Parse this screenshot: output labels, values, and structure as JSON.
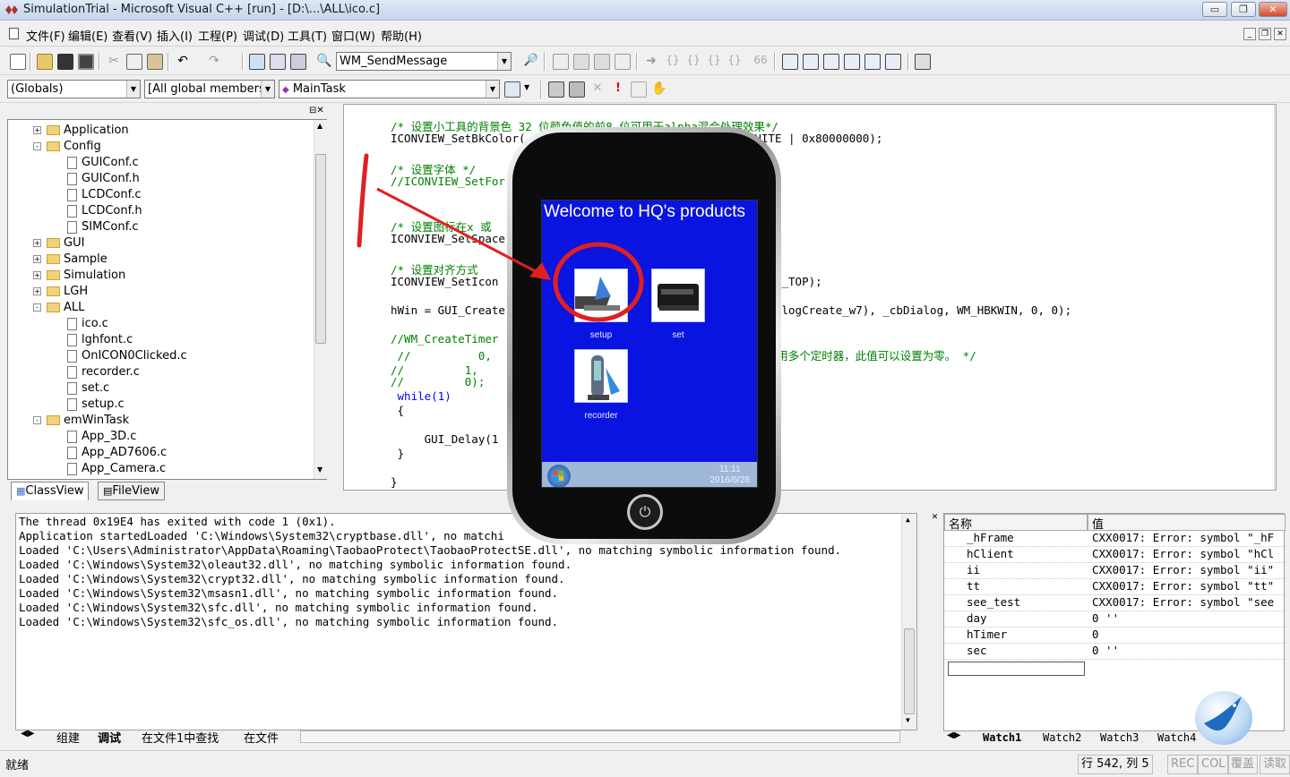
{
  "window": {
    "title": "SimulationTrial - Microsoft Visual C++ [run] - [D:\\...\\ALL\\ico.c]",
    "minimize": "▭",
    "restore": "❐",
    "close": "✕"
  },
  "menu": [
    "文件(F)",
    "编辑(E)",
    "查看(V)",
    "插入(I)",
    "工程(P)",
    "调试(D)",
    "工具(T)",
    "窗口(W)",
    "帮助(H)"
  ],
  "toolbar": {
    "find_combo": "WM_SendMessage",
    "scope_combo": "(Globals)",
    "members_combo": "[All global members",
    "function_combo": "MainTask"
  },
  "tree": {
    "items": [
      {
        "label": "Application",
        "type": "folder",
        "level": 1,
        "state": "+"
      },
      {
        "label": "Config",
        "type": "folder",
        "level": 1,
        "state": "-"
      },
      {
        "label": "GUIConf.c",
        "type": "file",
        "level": 2
      },
      {
        "label": "GUIConf.h",
        "type": "file",
        "level": 2
      },
      {
        "label": "LCDConf.c",
        "type": "file",
        "level": 2
      },
      {
        "label": "LCDConf.h",
        "type": "file",
        "level": 2
      },
      {
        "label": "SIMConf.c",
        "type": "file",
        "level": 2
      },
      {
        "label": "GUI",
        "type": "folder",
        "level": 1,
        "state": "+"
      },
      {
        "label": "Sample",
        "type": "folder",
        "level": 1,
        "state": "+"
      },
      {
        "label": "Simulation",
        "type": "folder",
        "level": 1,
        "state": "+"
      },
      {
        "label": "LGH",
        "type": "folder",
        "level": 1,
        "state": "+"
      },
      {
        "label": "ALL",
        "type": "folder",
        "level": 1,
        "state": "-"
      },
      {
        "label": "ico.c",
        "type": "file",
        "level": 2
      },
      {
        "label": "lghfont.c",
        "type": "file",
        "level": 2
      },
      {
        "label": "OnICON0Clicked.c",
        "type": "file",
        "level": 2
      },
      {
        "label": "recorder.c",
        "type": "file",
        "level": 2
      },
      {
        "label": "set.c",
        "type": "file",
        "level": 2
      },
      {
        "label": "setup.c",
        "type": "file",
        "level": 2
      },
      {
        "label": "emWinTask",
        "type": "folder",
        "level": 1,
        "state": "-"
      },
      {
        "label": "App_3D.c",
        "type": "file",
        "level": 2
      },
      {
        "label": "App_AD7606.c",
        "type": "file",
        "level": 2
      },
      {
        "label": "App_Camera.c",
        "type": "file",
        "level": 2
      }
    ],
    "tabs": [
      "ClassView",
      "FileView"
    ]
  },
  "editor": {
    "lines": [
      {
        "text": "/* 设置小工具的背景色 32 位颜色值的前8 位可用于alpha混合处理效果*/",
        "cls": "cm"
      },
      {
        "text": "ICONVIEW_SetBkColor(                                 WHITE | 0x80000000);",
        "cls": ""
      },
      {
        "text": "",
        "cls": ""
      },
      {
        "text": "/* 设置字体 */",
        "cls": "cm"
      },
      {
        "text": "//ICONVIEW_SetFor",
        "cls": "cm"
      },
      {
        "text": "",
        "cls": ""
      },
      {
        "text": "",
        "cls": ""
      },
      {
        "text": "/* 设置图标在x 或",
        "cls": "cm"
      },
      {
        "text": "ICONVIEW_SetSpace",
        "cls": ""
      },
      {
        "text": "",
        "cls": ""
      },
      {
        "text": "/* 设置对齐方式 ",
        "cls": "cm"
      },
      {
        "text": "ICONVIEW_SetIcon                                 ONVIEW_IA_TOP);",
        "cls": ""
      },
      {
        "text": "",
        "cls": ""
      },
      {
        "text": "hWin = GUI_Create                                TOF(_aDialogCreate_w7), _cbDialog, WM_HBKWIN, 0, 0);",
        "cls": ""
      },
      {
        "text": "",
        "cls": ""
      },
      {
        "text": "//WM_CreateTimer                                 ",
        "cls": "cm"
      },
      {
        "text": " //          0,                                  同一窗口使用多个定时器，此值可以设置为零。 */",
        "cls": "cm"
      },
      {
        "text": "//         1,                                    消息*/",
        "cls": "cm"
      },
      {
        "text": "//         0);",
        "cls": "cm"
      },
      {
        "text": " while(1)",
        "cls": "kw"
      },
      {
        "text": " {",
        "cls": ""
      },
      {
        "text": "",
        "cls": ""
      },
      {
        "text": "     GUI_Delay(1",
        "cls": ""
      },
      {
        "text": " }",
        "cls": ""
      },
      {
        "text": "",
        "cls": ""
      },
      {
        "text": "}",
        "cls": ""
      }
    ]
  },
  "output": {
    "lines": [
      "The thread 0x19E4 has exited with code 1 (0x1).",
      "Application startedLoaded 'C:\\Windows\\System32\\cryptbase.dll', no matchi",
      "Loaded 'C:\\Users\\Administrator\\AppData\\Roaming\\TaobaoProtect\\TaobaoProtectSE.dll', no matching symbolic information found.",
      "Loaded 'C:\\Windows\\System32\\oleaut32.dll', no matching symbolic information found.",
      "Loaded 'C:\\Windows\\System32\\crypt32.dll', no matching symbolic information found.",
      "Loaded 'C:\\Windows\\System32\\msasn1.dll', no matching symbolic information found.",
      "Loaded 'C:\\Windows\\System32\\sfc.dll', no matching symbolic information found.",
      "Loaded 'C:\\Windows\\System32\\sfc_os.dll', no matching symbolic information found."
    ],
    "tabs": [
      "组建",
      "调试",
      "在文件1中查找",
      "在文件"
    ]
  },
  "watch": {
    "col_name": "名称",
    "col_value": "值",
    "rows": [
      {
        "name": "_hFrame",
        "value": "CXX0017: Error: symbol \"_hF"
      },
      {
        "name": "hClient",
        "value": "CXX0017: Error: symbol \"hCl"
      },
      {
        "name": "ii",
        "value": "CXX0017: Error: symbol \"ii\""
      },
      {
        "name": "tt",
        "value": "CXX0017: Error: symbol \"tt\""
      },
      {
        "name": "see_test",
        "value": "CXX0017: Error: symbol \"see"
      },
      {
        "name": "day",
        "value": "0 ''"
      },
      {
        "name": "hTimer",
        "value": "0"
      },
      {
        "name": "sec",
        "value": "0 ''"
      }
    ],
    "tabs": [
      "Watch1",
      "Watch2",
      "Watch3",
      "Watch4"
    ]
  },
  "status": {
    "ready": "就绪",
    "position": "行 542, 列 5",
    "rec": "REC",
    "col": "COL",
    "ovr": "覆盖",
    "read": "读取"
  },
  "phone": {
    "welcome": "Welcome to HQ's products",
    "icons": [
      "setup",
      "set",
      "recorder"
    ],
    "time": "11:11",
    "date": "2016/6/28"
  }
}
